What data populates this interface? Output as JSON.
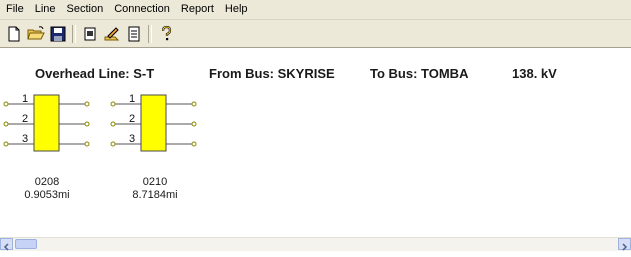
{
  "menu": [
    "File",
    "Line",
    "Section",
    "Connection",
    "Report",
    "Help"
  ],
  "toolbar_icons": [
    "new-file-icon",
    "open-folder-icon",
    "save-disk-icon",
    "copy-page-icon",
    "edit-pencil-icon",
    "notes-list-icon",
    "help-question-icon"
  ],
  "header": {
    "line": "Overhead Line: S-T",
    "from_bus": "From Bus: SKYRISE",
    "to_bus": "To Bus: TOMBA",
    "voltage": "138. kV"
  },
  "sections": [
    {
      "id": "0208",
      "length": "0.9053mi",
      "phases": [
        "1",
        "2",
        "3"
      ]
    },
    {
      "id": "0210",
      "length": "8.7184mi",
      "phases": [
        "1",
        "2",
        "3"
      ]
    }
  ],
  "colors": {
    "section_fill": "#ffff00",
    "section_stroke": "#4a4a4a",
    "menubar": "#ece9d8"
  }
}
